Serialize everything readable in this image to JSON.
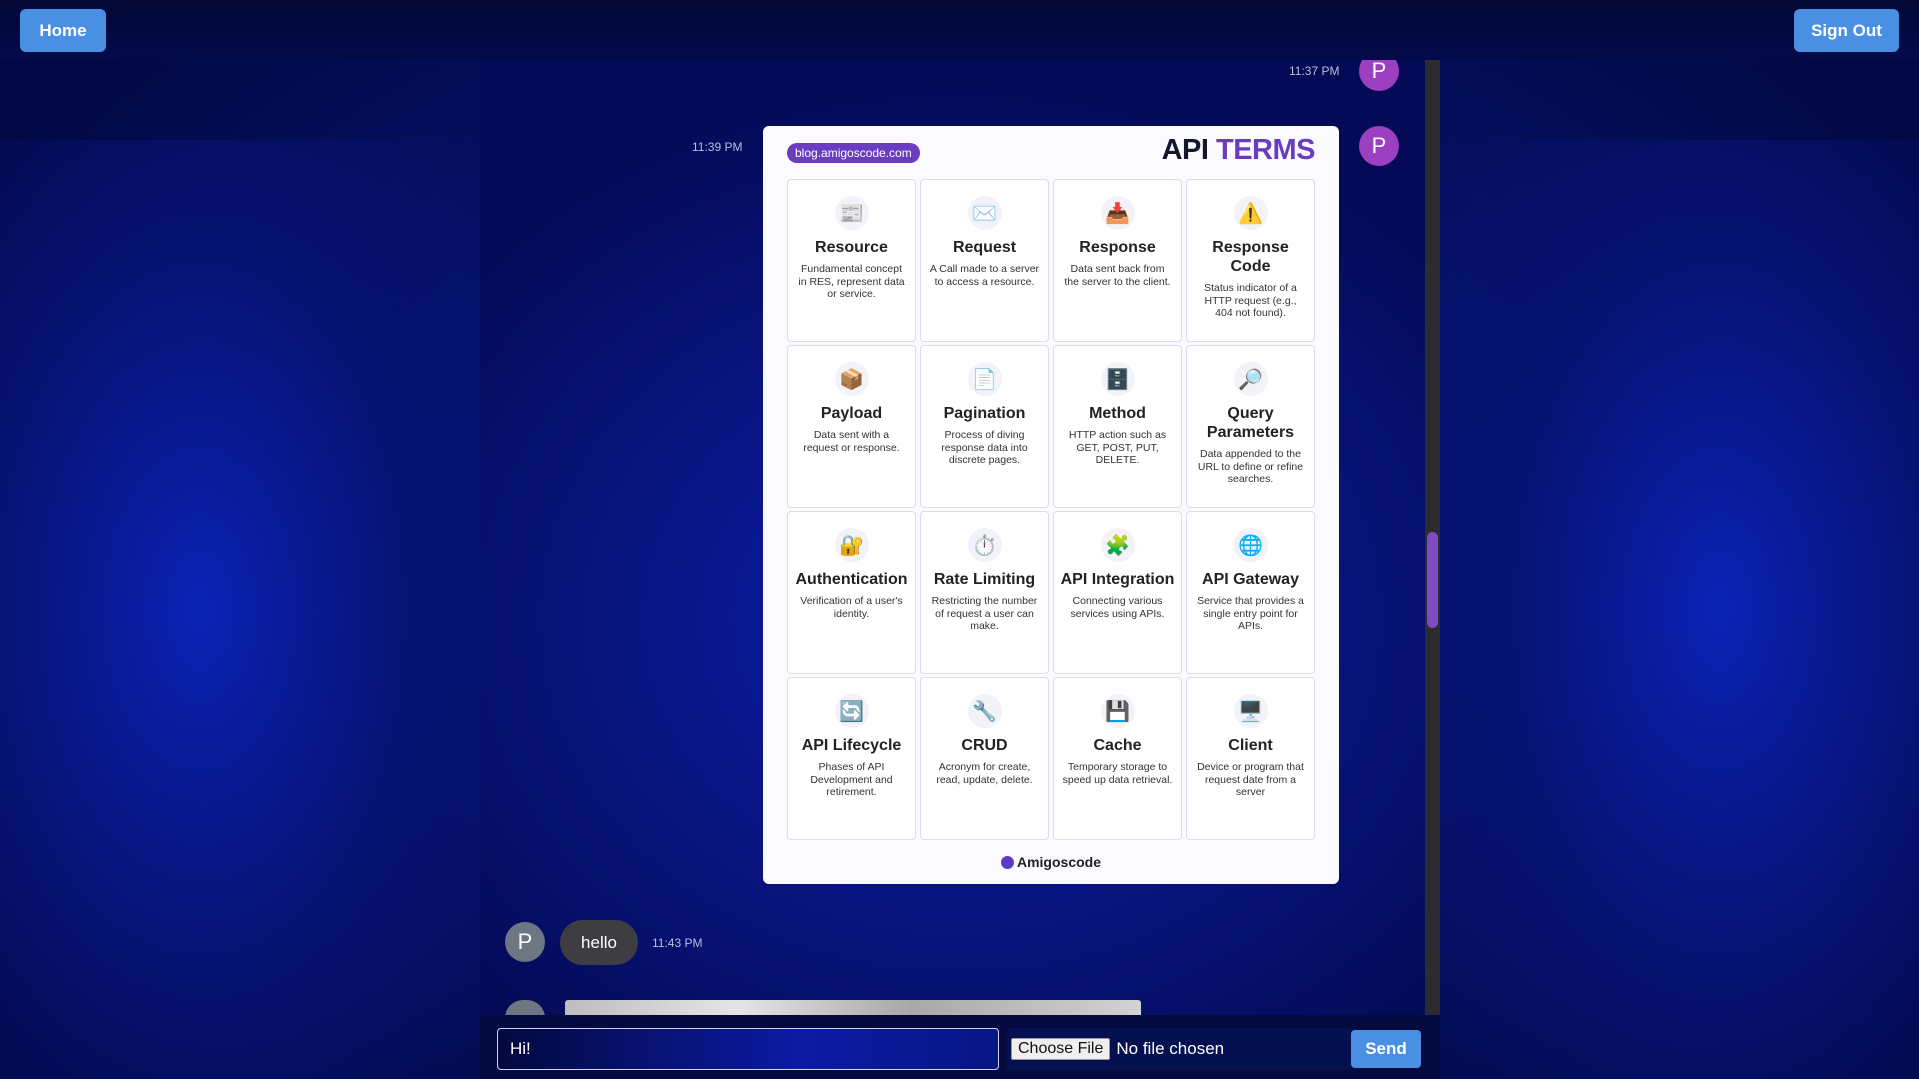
{
  "nav": {
    "home_label": "Home",
    "signout_label": "Sign Out"
  },
  "messages": [
    {
      "avatar": "P",
      "time": "11:37 PM"
    },
    {
      "avatar": "P",
      "time": "11:39 PM"
    },
    {
      "avatar": "P",
      "time": "11:43 PM",
      "text": "hello"
    }
  ],
  "api_card": {
    "source": "blog.amigoscode.com",
    "title_main": "API ",
    "title_accent": "TERMS",
    "brand": "Amigoscode",
    "terms": [
      {
        "icon": "📰",
        "name": "Resource",
        "desc": "Fundamental concept in RES, represent data or service."
      },
      {
        "icon": "✉️",
        "name": "Request",
        "desc": "A Call made to a server to access a resource."
      },
      {
        "icon": "📥",
        "name": "Response",
        "desc": "Data sent back from the server to the client."
      },
      {
        "icon": "⚠️",
        "name": "Response Code",
        "desc": "Status indicator of a HTTP request (e.g., 404 not found)."
      },
      {
        "icon": "📦",
        "name": "Payload",
        "desc": "Data sent with a request or response."
      },
      {
        "icon": "📄",
        "name": "Pagination",
        "desc": "Process of diving response data into discrete pages."
      },
      {
        "icon": "🗄️",
        "name": "Method",
        "desc": "HTTP action such as GET, POST, PUT, DELETE."
      },
      {
        "icon": "🔎",
        "name": "Query Parameters",
        "desc": "Data appended to the URL to define or refine searches."
      },
      {
        "icon": "🔐",
        "name": "Authentication",
        "desc": "Verification of a user's identity."
      },
      {
        "icon": "⏱️",
        "name": "Rate Limiting",
        "desc": "Restricting the number of request a user can make."
      },
      {
        "icon": "🧩",
        "name": "API Integration",
        "desc": "Connecting various services using APIs."
      },
      {
        "icon": "🌐",
        "name": "API Gateway",
        "desc": "Service that provides a single entry point for APIs."
      },
      {
        "icon": "🔄",
        "name": "API Lifecycle",
        "desc": "Phases of API Development and retirement."
      },
      {
        "icon": "🔧",
        "name": "CRUD",
        "desc": "Acronym for create, read, update, delete."
      },
      {
        "icon": "💾",
        "name": "Cache",
        "desc": "Temporary storage to speed up data retrieval."
      },
      {
        "icon": "🖥️",
        "name": "Client",
        "desc": "Device or program that request date from a server"
      }
    ]
  },
  "composer": {
    "input_value": "Hi!",
    "choose_file_label": "Choose File",
    "no_file_label": "No file chosen",
    "send_label": "Send"
  },
  "colors": {
    "accent": "#4a90e2",
    "avatar_purple": "#9c3fc0",
    "scroll_thumb": "#7c4cc1"
  }
}
